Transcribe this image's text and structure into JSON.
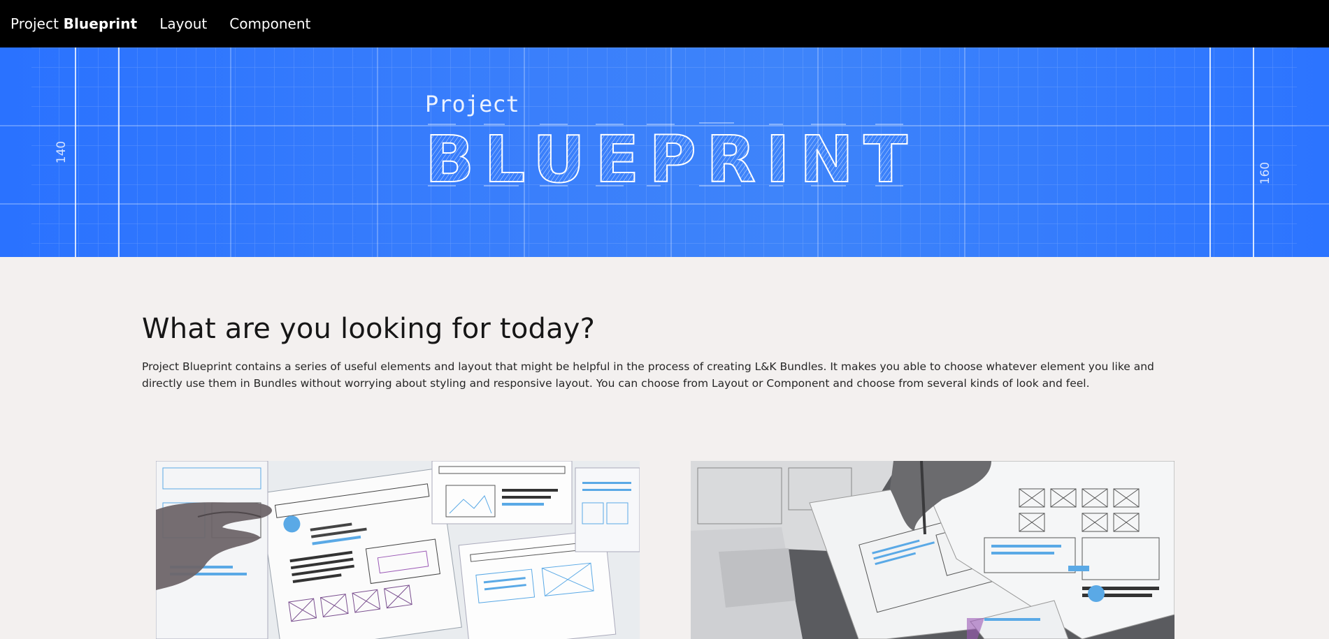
{
  "nav": {
    "brand_prefix": "Project",
    "brand_bold": "Blueprint",
    "links": [
      {
        "label": "Layout"
      },
      {
        "label": "Component"
      }
    ]
  },
  "hero": {
    "small_word": "Project",
    "big_word": "BLUEPRINT",
    "left_dimension": "140",
    "right_dimension": "160",
    "colors": {
      "primary": "#2a72ff",
      "line": "#ffffff"
    }
  },
  "main": {
    "headline": "What are you looking for today?",
    "intro": "Project Blueprint contains a series of useful elements and layout that might be helpful in the process of creating L&K Bundles. It makes you able to choose whatever element you like and directly use them in Bundles without worrying about styling and responsive layout. You can choose from Layout or Component and choose from several kinds of look and feel."
  },
  "colors": {
    "nav_bg": "#000000",
    "page_bg": "#f3f0ef",
    "sketch_blue": "#4aa3e8"
  }
}
